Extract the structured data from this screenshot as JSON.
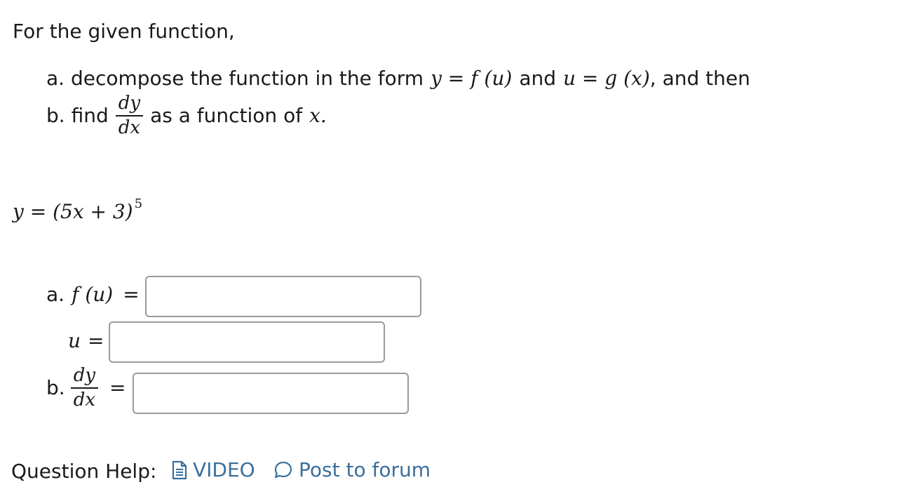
{
  "intro": "For the given function,",
  "instructions": {
    "a_prefix": "a. decompose the function in the form",
    "a_eq1": "y = f (u)",
    "a_and": "and",
    "a_eq2": "u = g (x)",
    "a_suffix": ", and then",
    "b_prefix": "b. find",
    "b_num": "dy",
    "b_den": "dx",
    "b_suffix": "as a function of",
    "b_var": "x."
  },
  "function": {
    "lhs": "y = (5x + 3)",
    "exponent": "5"
  },
  "answers": {
    "a_label": "a.",
    "fu_label": "f (u)",
    "u_label": "u",
    "equals": "=",
    "b_label": "b.",
    "b_num": "dy",
    "b_den": "dx",
    "fu_value": "",
    "u_value": "",
    "dydx_value": ""
  },
  "help": {
    "label": "Question Help:",
    "video": "VIDEO",
    "forum": "Post to forum",
    "link_color": "#3a6f9c",
    "icons": [
      "document-icon",
      "speech-bubble-icon"
    ]
  }
}
